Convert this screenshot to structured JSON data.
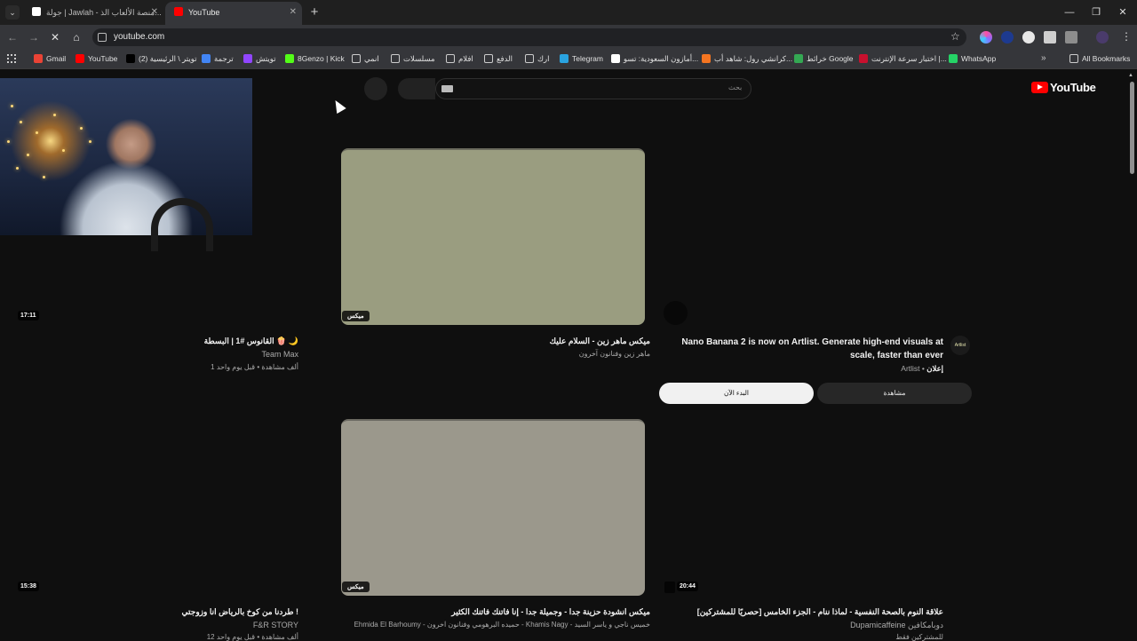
{
  "browser": {
    "tab_menu_icon": "chevron-down-icon",
    "tabs": [
      {
        "label": "جولة | Jawlah - منصة الألعاب الذ...",
        "icon_color": "#ffffff"
      },
      {
        "label": "YouTube",
        "icon_color": "#ff0000"
      }
    ],
    "new_tab": "+",
    "window": {
      "minimize": "—",
      "restore": "❐",
      "close": "✕"
    },
    "back": "←",
    "forward": "→",
    "reload": "✕",
    "home": "⌂",
    "url": "youtube.com",
    "bookmark_star": "☆",
    "bookmarks": [
      {
        "label": "Gmail",
        "color": "#ea4335"
      },
      {
        "label": "YouTube",
        "color": "#ff0000"
      },
      {
        "label": "(2) تويتر \\ الرئيسية",
        "color": "#000000"
      },
      {
        "label": "ترجمة",
        "color": "#4285f4"
      },
      {
        "label": "تويتش",
        "color": "#9146ff"
      },
      {
        "label": "8Genzo | Kick",
        "color": "#53fc18"
      },
      {
        "label": "انمي",
        "color": "#00000000"
      },
      {
        "label": "مسلسلات",
        "color": "#00000000"
      },
      {
        "label": "افلام",
        "color": "#00000000"
      },
      {
        "label": "الدفع",
        "color": "#00000000"
      },
      {
        "label": "ارك",
        "color": "#00000000"
      },
      {
        "label": "Telegram",
        "color": "#2aa3e0"
      },
      {
        "label": "أمازون السعودية: تسو...",
        "color": "#ffffff"
      },
      {
        "label": "كرانشي رول: شاهد أب...",
        "color": "#f47521"
      },
      {
        "label": "خرائط Google",
        "color": "#34a853"
      },
      {
        "label": "اختبار سرعة الإنترنت |...",
        "color": "#c8102e"
      },
      {
        "label": "WhatsApp",
        "color": "#25d366"
      }
    ],
    "bookmarks_overflow": "»",
    "all_bookmarks": "All Bookmarks"
  },
  "youtube": {
    "logo_text": "YouTube",
    "search_placeholder": "بحث",
    "videos": [
      {
        "duration": "17:11",
        "title": "القانوس #1 | البسطة 🍿 🌙",
        "channel": "Team Max",
        "stats": "1 ألف مشاهدة • قبل يوم واحد"
      },
      {
        "badge": "ميكس",
        "title": "ميكس ماهر زين - السلام عليك",
        "channel": "ماهر زين وفنانون آخرون"
      },
      {
        "badge": "ميكس",
        "title": "ميكس انشودة حزينة جدا - وجميلة جدا - إنا فاتنك فاتنك الكثير",
        "channel": "Ehmida El Barhoumy - حميده البرهومي وفنانون آخرون - Khamis Nagy - خميس ناجي و ياسر السيد"
      },
      {
        "duration": "15:38",
        "title": "طردنا من كوخ بالرياض انا وزوجتي !",
        "channel": "F&R STORY",
        "stats": "12 ألف مشاهدة • قبل يوم واحد"
      },
      {
        "duration": "20:44",
        "title": "[حصريًا للمشتركين] علاقة النوم بالصحة النفسية - لماذا ننام - الجزء الخامس",
        "channel": "Dupamicaffeine دوبامكافين",
        "stats": "للمشتركين فقط"
      }
    ],
    "ad": {
      "title": "Nano Banana 2 is now on Artlist. Generate high-end visuals at scale, faster than ever",
      "label": "إعلان",
      "advertiser": "Artlist",
      "avatar_text": "Artlist",
      "start_button": "البدء الآن",
      "watch_button": "مشاهدة"
    }
  }
}
